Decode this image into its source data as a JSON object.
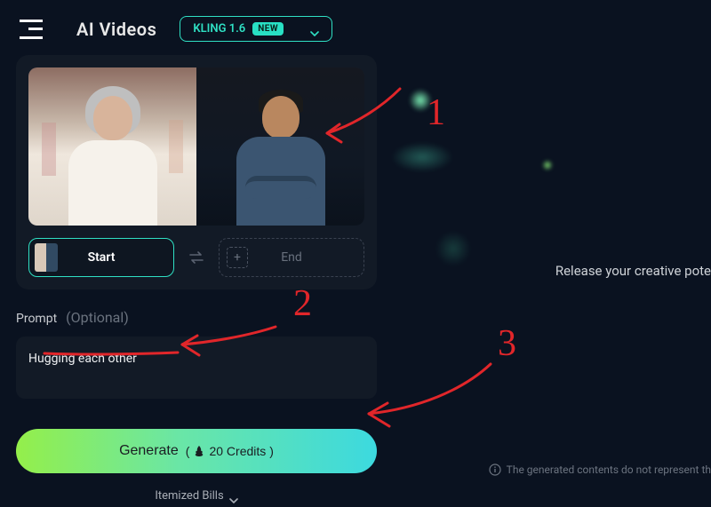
{
  "header": {
    "title": "AI Videos",
    "model_name": "KLING 1.6",
    "new_badge": "NEW"
  },
  "frames": {
    "start_label": "Start",
    "end_label": "End"
  },
  "prompt": {
    "label": "Prompt",
    "optional": "(Optional)",
    "value": "Hugging each other"
  },
  "generate": {
    "label": "Generate",
    "credits_text": "20 Credits"
  },
  "itemized_label": "Itemized Bills",
  "right_tagline": "Release your creative pote",
  "disclaimer": "The generated contents do not represent th",
  "annotations": {
    "n1": "1",
    "n2": "2",
    "n3": "3"
  }
}
